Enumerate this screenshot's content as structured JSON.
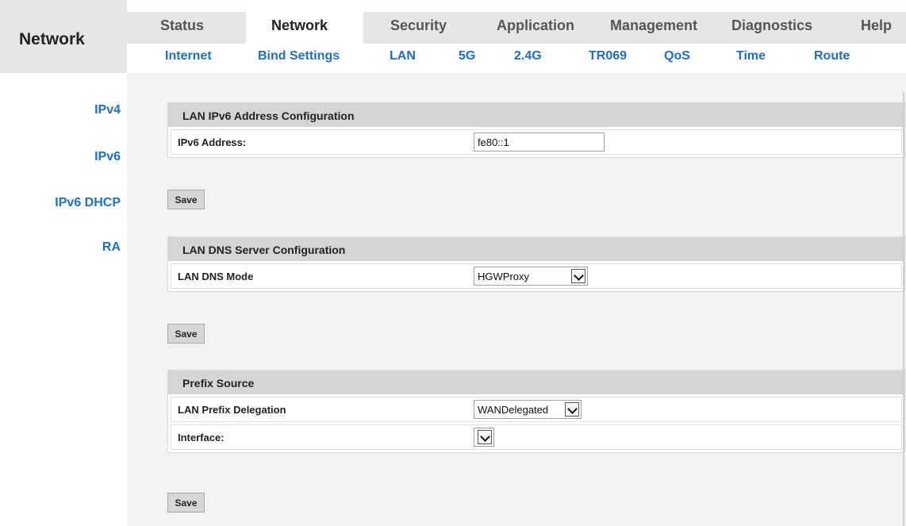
{
  "header": {
    "brand": "Network",
    "tabs": [
      "Status",
      "Network",
      "Security",
      "Application",
      "Management",
      "Diagnostics",
      "Help"
    ],
    "subtabs": [
      "Internet",
      "Bind Settings",
      "LAN",
      "5G",
      "2.4G",
      "TR069",
      "QoS",
      "Time",
      "Route"
    ]
  },
  "sidebar": {
    "items": [
      "IPv4",
      "IPv6",
      "IPv6 DHCP",
      "RA"
    ]
  },
  "sections": {
    "ipv6_address": {
      "title": "LAN IPv6 Address Configuration",
      "label": "IPv6 Address:",
      "value": "fe80::1"
    },
    "dns": {
      "title": "LAN DNS Server Configuration",
      "label": "LAN DNS Mode",
      "selected": "HGWProxy"
    },
    "prefix": {
      "title": "Prefix Source",
      "delegation_label": "LAN Prefix Delegation",
      "delegation_selected": "WANDelegated",
      "interface_label": "Interface:",
      "interface_selected": ""
    }
  },
  "buttons": {
    "save": "Save"
  }
}
